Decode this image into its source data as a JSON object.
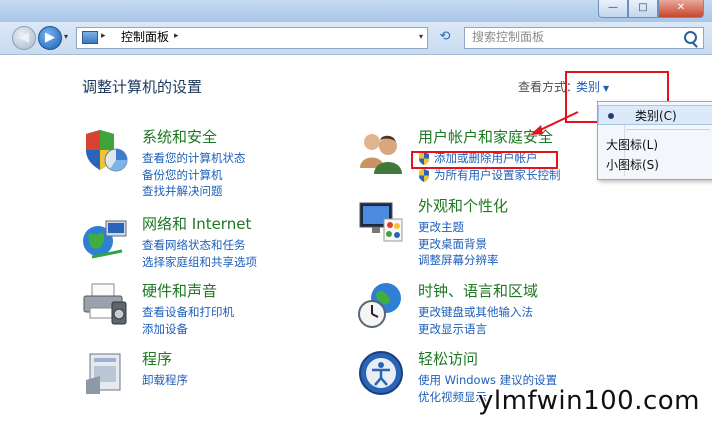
{
  "window": {
    "title": "",
    "buttons": {
      "minimize": "—",
      "maximize": "□",
      "close": "✕"
    }
  },
  "address_bar": {
    "path": "控制面板",
    "separator": "▸",
    "dropdown": "▾"
  },
  "search": {
    "placeholder": "搜索控制面板"
  },
  "main": {
    "heading": "调整计算机的设置",
    "view_by_label": "查看方式：",
    "view_by_value": "类别"
  },
  "view_menu": {
    "items": [
      {
        "label": "类别(C)",
        "selected": true
      },
      {
        "label": "大图标(L)",
        "selected": false
      },
      {
        "label": "小图标(S)",
        "selected": false
      }
    ]
  },
  "categories": [
    {
      "id": "system-security",
      "icon": "shield-chart-icon",
      "title": "系统和安全",
      "links": [
        "查看您的计算机状态",
        "备份您的计算机",
        "查找并解决问题"
      ]
    },
    {
      "id": "network-internet",
      "icon": "globe-network-icon",
      "title": "网络和 Internet",
      "links": [
        "查看网络状态和任务",
        "选择家庭组和共享选项"
      ]
    },
    {
      "id": "hardware-sound",
      "icon": "printer-icon",
      "title": "硬件和声音",
      "links": [
        "查看设备和打印机",
        "添加设备"
      ]
    },
    {
      "id": "programs",
      "icon": "programs-icon",
      "title": "程序",
      "links": [
        "卸载程序"
      ]
    },
    {
      "id": "user-accounts",
      "icon": "users-icon",
      "title": "用户帐户和家庭安全",
      "links": [
        "添加或删除用户帐户",
        "为所有用户设置家长控制"
      ]
    },
    {
      "id": "appearance",
      "icon": "monitor-palette-icon",
      "title": "外观和个性化",
      "links": [
        "更改主题",
        "更改桌面背景",
        "调整屏幕分辨率"
      ]
    },
    {
      "id": "clock-region",
      "icon": "clock-globe-icon",
      "title": "时钟、语言和区域",
      "links": [
        "更改键盘或其他输入法",
        "更改显示语言"
      ]
    },
    {
      "id": "ease-access",
      "icon": "ease-access-icon",
      "title": "轻松访问",
      "links": [
        "使用 Windows 建议的设置",
        "优化视频显示"
      ]
    }
  ],
  "watermark": "ylmfwin100.com",
  "colors": {
    "category_title": "#1e7722",
    "link": "#1e5fba",
    "highlight_box": "#e3121b"
  }
}
